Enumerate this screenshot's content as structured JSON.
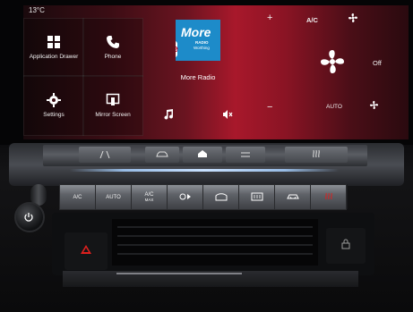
{
  "status": {
    "temperature": "13°C",
    "top_label": "AUTO"
  },
  "tiles": [
    {
      "key": "app_drawer",
      "label": "Application Drawer",
      "icon": "grid-icon"
    },
    {
      "key": "phone",
      "label": "Phone",
      "icon": "phone-icon"
    },
    {
      "key": "settings",
      "label": "Settings",
      "icon": "gear-icon"
    },
    {
      "key": "mirror",
      "label": "Mirror Screen",
      "icon": "mirror-screen-icon"
    }
  ],
  "radio": {
    "logo_title": "More",
    "logo_line1": "RADIO",
    "logo_line2": "Worthing",
    "logo_edge": "he",
    "station_name": "More Radio",
    "controls": [
      "music-note-icon",
      "mute-icon"
    ]
  },
  "climate_panel": {
    "plus": "+",
    "minus": "−",
    "ac_label": "A/C",
    "off_label": "Off",
    "auto_label": "AUTO",
    "fan_icon": "fan-icon"
  },
  "physical_buttons_top": [
    "lane-assist-icon",
    "park-assist-icon",
    "car-icon",
    "home-icon",
    "driver-assist-icon",
    "heated-wheel-icon"
  ],
  "climate_buttons": [
    {
      "label": "A/C"
    },
    {
      "label": "AUTO"
    },
    {
      "label": "A/C",
      "sub": "MAX"
    },
    {
      "label": "",
      "icon": "fan-speed-icon"
    },
    {
      "label": "",
      "icon": "windscreen-demist-icon"
    },
    {
      "label": "",
      "icon": "rear-demist-icon"
    },
    {
      "label": "",
      "icon": "recirculation-icon"
    },
    {
      "label": "",
      "icon": "seat-heat-icon"
    }
  ],
  "colors": {
    "screen_accent": "#a8182b",
    "logo_blue": "#1d8bc9",
    "hazard_red": "#e0201e",
    "light_bar": "#a0c8f5"
  }
}
